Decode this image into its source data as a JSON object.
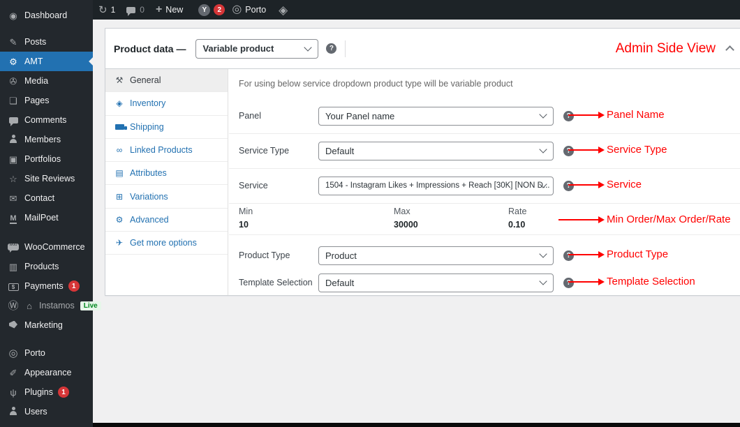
{
  "topbar": {
    "updates_count": "1",
    "comments_count": "0",
    "new_label": "New",
    "yoast_badge": "2",
    "porto_label": "Porto"
  },
  "sidebar": {
    "items": [
      {
        "label": "Dashboard"
      },
      {
        "label": "Posts"
      },
      {
        "label": "AMT",
        "active": true
      },
      {
        "label": "Media"
      },
      {
        "label": "Pages"
      },
      {
        "label": "Comments"
      },
      {
        "label": "Members"
      },
      {
        "label": "Portfolios"
      },
      {
        "label": "Site Reviews"
      },
      {
        "label": "Contact"
      },
      {
        "label": "MailPoet"
      },
      {
        "label": "WooCommerce"
      },
      {
        "label": "Products"
      },
      {
        "label": "Payments",
        "badge": "1"
      },
      {
        "label": "Instamos",
        "live_badge": "Live"
      },
      {
        "label": "Marketing"
      },
      {
        "label": "Porto"
      },
      {
        "label": "Appearance"
      },
      {
        "label": "Plugins",
        "badge": "1"
      },
      {
        "label": "Users"
      }
    ]
  },
  "product_box": {
    "title": "Product data —",
    "product_type_select": "Variable product",
    "annotation_title": "Admin Side View",
    "tabs": [
      {
        "label": "General",
        "active": true
      },
      {
        "label": "Inventory"
      },
      {
        "label": "Shipping"
      },
      {
        "label": "Linked Products"
      },
      {
        "label": "Attributes"
      },
      {
        "label": "Variations"
      },
      {
        "label": "Advanced"
      },
      {
        "label": "Get more options"
      }
    ],
    "info_text": "For using below service dropdown product type will be variable product",
    "fields": [
      {
        "label": "Panel",
        "value": "Your Panel name",
        "annotation": "Panel Name"
      },
      {
        "label": "Service Type",
        "value": "Default",
        "annotation": "Service Type"
      },
      {
        "label": "Service",
        "value": "1504 - Instagram Likes + Impressions + Reach [30K] [NON D...",
        "annotation": "Service"
      },
      {
        "label": "Product Type",
        "value": "Product",
        "annotation": "Product Type"
      },
      {
        "label": "Template Selection",
        "value": "Default",
        "annotation": "Template Selection"
      }
    ],
    "min_max_rate": {
      "min_label": "Min",
      "min_value": "10",
      "max_label": "Max",
      "max_value": "30000",
      "rate_label": "Rate",
      "rate_value": "0.10",
      "annotation": "Min Order/Max Order/Rate"
    }
  },
  "icons": {
    "update": "↻",
    "new_plus": "+",
    "yoast_logo": "Y",
    "porto_logo": "◎",
    "gem": "◈",
    "dashboard": "◉",
    "posts": "✎",
    "amt": "⚙",
    "media": "✇",
    "pages": "❏",
    "portfolios": "▣",
    "site_reviews": "☆",
    "contact": "✉",
    "mailpoet": "M",
    "products": "▥",
    "payments_dollar": "$",
    "wp_logo": "Ⓦ",
    "home": "⌂",
    "appearance": "✐",
    "plugins": "ψ",
    "tab_general": "⚒",
    "tab_inventory": "◈",
    "tab_linked": "∞",
    "tab_attributes": "▤",
    "tab_variations": "⊞",
    "tab_advanced": "⚙",
    "tab_more": "✈",
    "help": "?"
  },
  "colors": {
    "topbar_bg": "#1d2327",
    "sidebar_bg": "#23282d",
    "active_blue": "#2271b1",
    "content_bg": "#f0f0f1",
    "annotation_red": "#ff0000",
    "badge_red": "#d63638",
    "live_green": "#00881f",
    "link_blue": "#2271b1"
  }
}
